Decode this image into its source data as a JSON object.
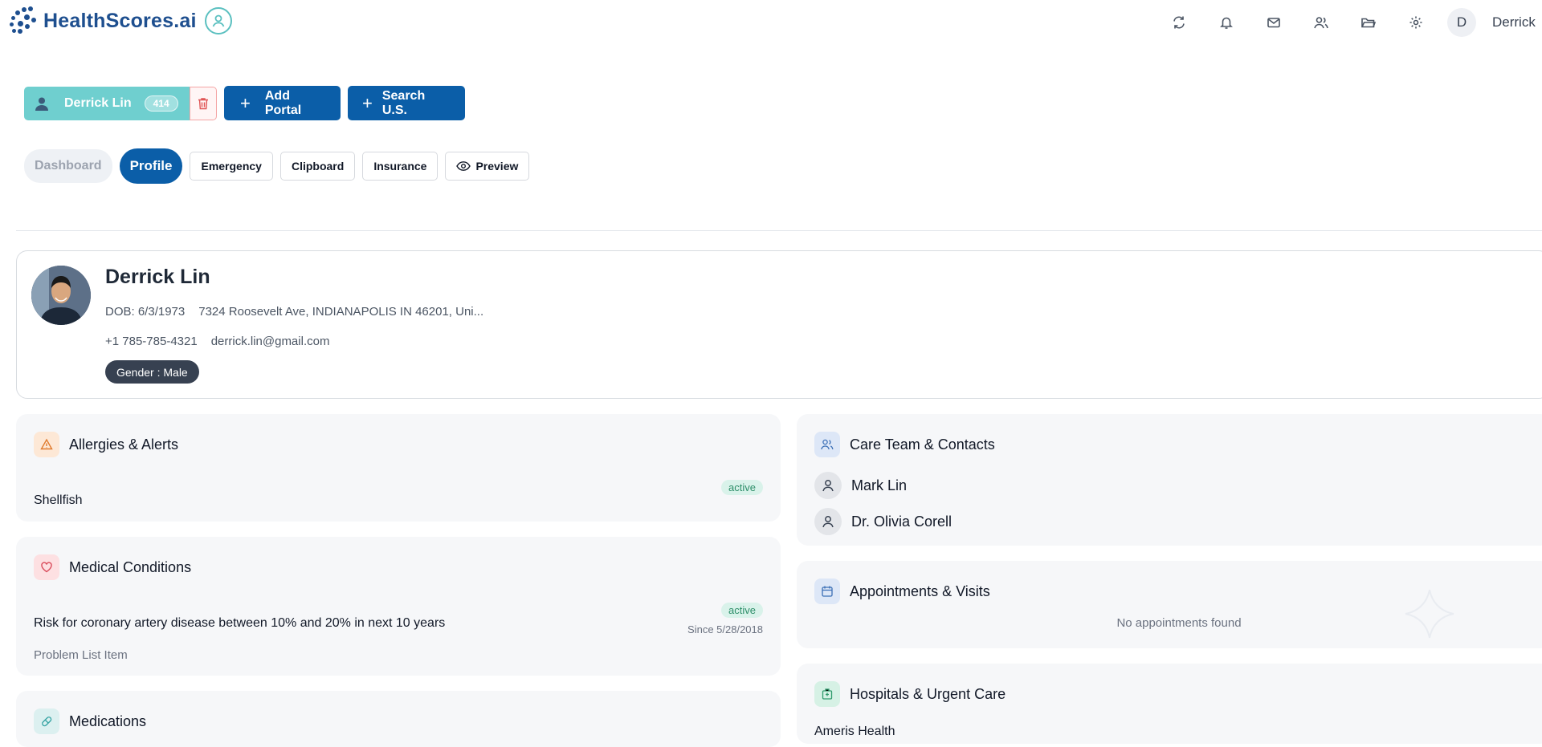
{
  "brand": {
    "name": "HealthScores.ai"
  },
  "topbar": {
    "icons": [
      "refresh-icon",
      "bell-icon",
      "mail-icon",
      "users-icon",
      "folder-icon",
      "gear-icon"
    ],
    "avatar_initial": "D",
    "user_name": "Derrick"
  },
  "toolbar": {
    "patient_name": "Derrick Lin",
    "patient_badge": "414",
    "add_portal_label": "Add Portal",
    "search_label": "Search U.S."
  },
  "tabs": {
    "dashboard": "Dashboard",
    "profile": "Profile",
    "emergency": "Emergency",
    "clipboard": "Clipboard",
    "insurance": "Insurance",
    "preview": "Preview"
  },
  "profile": {
    "name": "Derrick Lin",
    "dob": "DOB: 6/3/1973",
    "address": "7324 Roosevelt Ave, INDIANAPOLIS IN 46201, Uni...",
    "phone": "+1 785-785-4321",
    "email": "derrick.lin@gmail.com",
    "gender": "Gender : Male"
  },
  "allergies": {
    "title": "Allergies & Alerts",
    "items": [
      {
        "name": "Shellfish",
        "status": "active"
      }
    ]
  },
  "conditions": {
    "title": "Medical Conditions",
    "items": [
      {
        "name": "Risk for coronary artery disease between 10% and 20% in next 10 years",
        "status": "active",
        "since": "Since 5/28/2018",
        "category": "Problem List Item"
      }
    ]
  },
  "medications": {
    "title": "Medications"
  },
  "care_team": {
    "title": "Care Team & Contacts",
    "contacts": [
      "Mark Lin",
      "Dr. Olivia Corell"
    ]
  },
  "appointments": {
    "title": "Appointments & Visits",
    "empty": "No appointments found"
  },
  "hospitals": {
    "title": "Hospitals & Urgent Care",
    "first": "Ameris Health"
  },
  "colors": {
    "primary": "#0b5ea8",
    "teal": "#6fcfcf",
    "card_bg": "#f6f7f9",
    "status_bg": "#d9f2ea"
  }
}
